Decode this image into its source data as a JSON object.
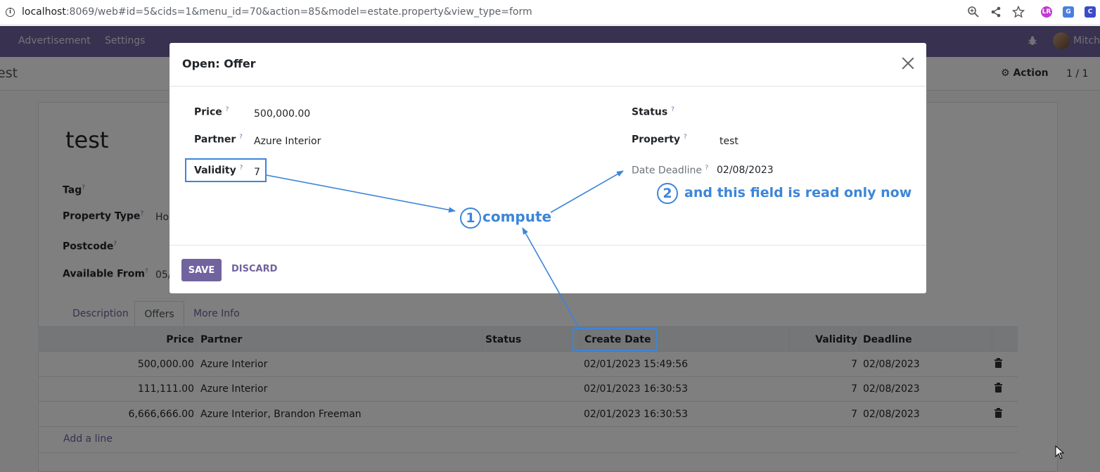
{
  "browser": {
    "url_host": "localhost",
    "url_rest": ":8069/web#id=5&cids=1&menu_id=70&action=85&model=estate.property&view_type=form"
  },
  "navbar": {
    "menus": [
      "Advertisement",
      "Settings"
    ],
    "user": "Mitch"
  },
  "control": {
    "breadcrumb": "est",
    "action_label": "Action",
    "pager": "1 / 1"
  },
  "record": {
    "title": "test",
    "fields": [
      {
        "label": "Tag",
        "value": ""
      },
      {
        "label": "Property Type",
        "value": "Ho"
      },
      {
        "label": "Postcode",
        "value": ""
      },
      {
        "label": "Available From",
        "value": "05/"
      }
    ],
    "help_mark": "?",
    "tabs": [
      "Description",
      "Offers",
      "More Info"
    ],
    "active_tab": "Offers"
  },
  "offers": {
    "columns": [
      "Price",
      "Partner",
      "Status",
      "Create Date",
      "Validity",
      "Deadline"
    ],
    "rows": [
      {
        "price": "500,000.00",
        "partner": "Azure Interior",
        "status": "",
        "create_date": "02/01/2023 15:49:56",
        "validity": "7",
        "deadline": "02/08/2023"
      },
      {
        "price": "111,111.00",
        "partner": "Azure Interior",
        "status": "",
        "create_date": "02/01/2023 16:30:53",
        "validity": "7",
        "deadline": "02/08/2023"
      },
      {
        "price": "6,666,666.00",
        "partner": "Azure Interior, Brandon Freeman",
        "status": "",
        "create_date": "02/01/2023 16:30:53",
        "validity": "7",
        "deadline": "02/08/2023"
      }
    ],
    "add_line": "Add a line"
  },
  "modal": {
    "title": "Open: Offer",
    "price_label": "Price",
    "price_value": "500,000.00",
    "partner_label": "Partner",
    "partner_value": "Azure Interior",
    "validity_label": "Validity",
    "validity_value": "7",
    "status_label": "Status",
    "status_value": "",
    "property_label": "Property",
    "property_value": "test",
    "deadline_label": "Date Deadline",
    "deadline_value": "02/08/2023",
    "save_label": "SAVE",
    "discard_label": "DISCARD"
  },
  "annotations": {
    "step1_num": "1",
    "step1_text": "compute",
    "step2_num": "2",
    "step2_text": "and this field is read only now",
    "color": "#3d85d8"
  },
  "colors": {
    "brand": "#71639e",
    "annotation": "#3d85d8"
  }
}
